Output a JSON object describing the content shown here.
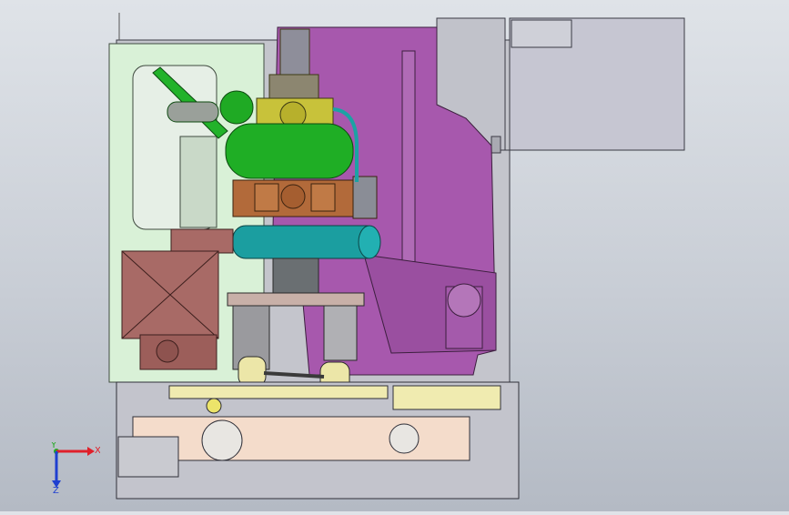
{
  "viewport": {
    "background_top": "#dfe3e8",
    "background_bottom": "#b4bac4"
  },
  "triad": {
    "x_label": "X",
    "y_label": "Y",
    "z_label": "Z",
    "x_color": "#e0202a",
    "y_color": "#22aa22",
    "z_color": "#1f3fd0"
  },
  "model_colors": {
    "housing_gray": "#bfc0c8",
    "side_panel_green": "#d8f2d6",
    "chamber_purple": "#a758ad",
    "engine_yellow": "#c8c23a",
    "tank_green": "#1fae25",
    "block_brown": "#b26a3a",
    "cylinder_teal": "#1b9ea0",
    "gearbox_red": "#a86a66",
    "lower_beige": "#f4dccb",
    "rail_yellow": "#f0ebb0"
  }
}
